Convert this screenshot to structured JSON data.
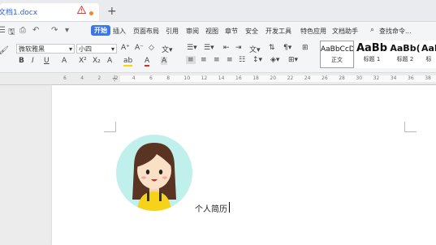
{
  "tab": {
    "title": "文档1.docx",
    "new_tab": "+"
  },
  "menu": {
    "items": [
      "开始",
      "插入",
      "页面布局",
      "引用",
      "审阅",
      "视图",
      "章节",
      "安全",
      "开发工具",
      "特色应用",
      "文档助手"
    ],
    "search_label": "查找命令..."
  },
  "ribbon": {
    "font_name": "微软雅黑",
    "font_size": "小四",
    "font_buttons": [
      "B",
      "I",
      "U",
      "A",
      "X²",
      "X₂",
      "A",
      "ab",
      "A",
      "A"
    ],
    "grow_font": "A⁺",
    "shrink_font": "A⁻",
    "styles": [
      {
        "sample": "AaBbCcD",
        "label": "正文"
      },
      {
        "sample": "AaBb",
        "label": "标题 1"
      },
      {
        "sample": "AaBb(",
        "label": "标题 2"
      },
      {
        "sample": "AaI",
        "label": "标"
      }
    ]
  },
  "ruler": {
    "ticks": [
      "6",
      "4",
      "2",
      "2",
      "4",
      "6",
      "8",
      "10",
      "12",
      "14",
      "16",
      "18",
      "20",
      "22",
      "24",
      "26",
      "28",
      "30",
      "32",
      "34",
      "36",
      "38"
    ]
  },
  "document": {
    "text": "个人简历"
  },
  "colors": {
    "accent": "#3a76e8",
    "tab_title": "#2b5fd9",
    "avatar_bg": "#bff0ec"
  }
}
